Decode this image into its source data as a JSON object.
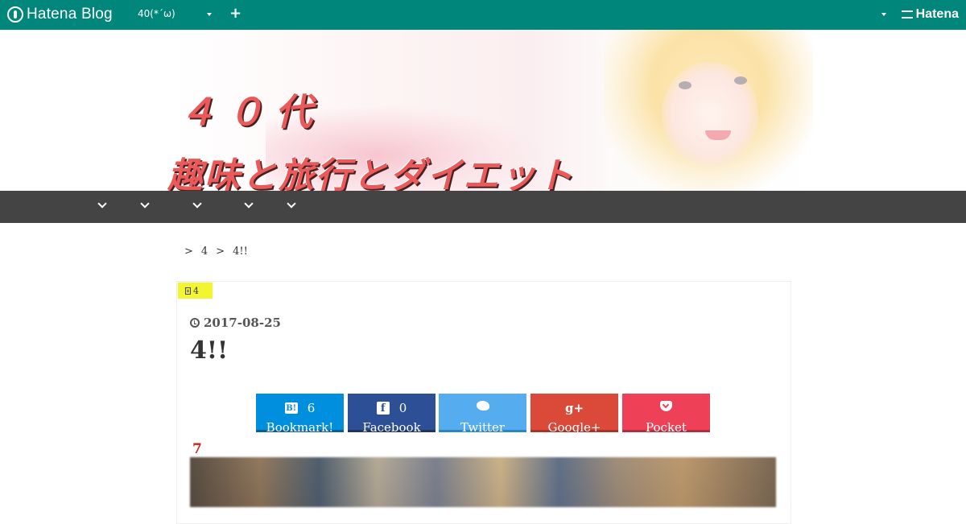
{
  "topbar": {
    "brand": "Hatena Blog",
    "blog_selector": "40(*´ω)",
    "right_brand": "Hatena"
  },
  "header": {
    "title_line1": "４０代",
    "title_line2": "趣味と旅行とダイエット"
  },
  "nav": {
    "items": [
      "",
      "",
      "",
      "",
      ""
    ]
  },
  "breadcrumb": {
    "separator": ">",
    "items": [
      "4",
      "4!!"
    ]
  },
  "entry": {
    "category": "4",
    "date": "2017-08-25",
    "title": "4!!",
    "section_heading": "7"
  },
  "share_buttons": [
    {
      "name": "Bookmark!",
      "count": "6",
      "icon": "hatena-bookmark-icon",
      "color": "#008fde"
    },
    {
      "name": "Facebook",
      "count": "0",
      "icon": "facebook-icon",
      "color": "#2c4f95"
    },
    {
      "name": "Twitter",
      "count": "",
      "icon": "twitter-icon",
      "color": "#55acee"
    },
    {
      "name": "Google+",
      "count": "",
      "icon": "google-plus-icon",
      "color": "#db4a39"
    },
    {
      "name": "Pocket",
      "count": "",
      "icon": "pocket-icon",
      "color": "#ee4056"
    }
  ],
  "colors": {
    "topbar": "#00867a",
    "navbar": "#444444",
    "category_tag": "#f3f531",
    "heading_red": "#d21e1e"
  }
}
